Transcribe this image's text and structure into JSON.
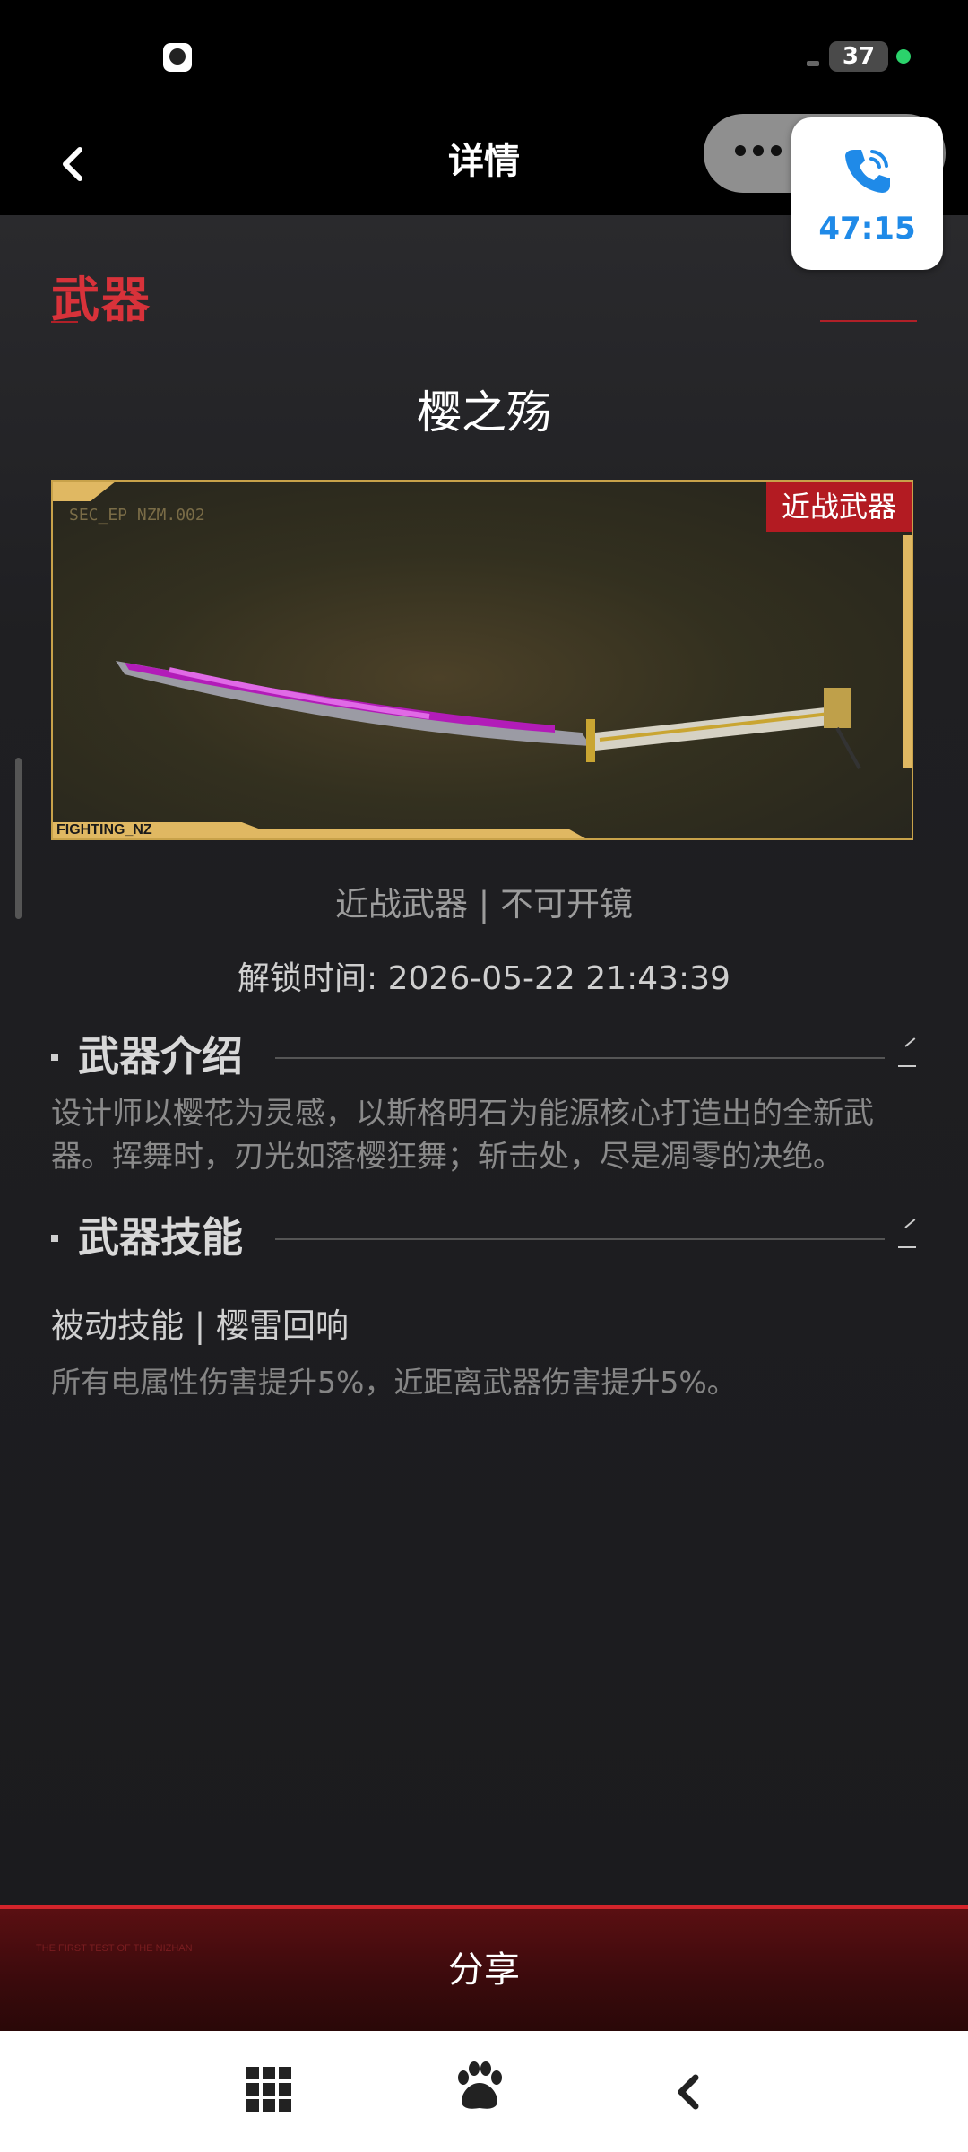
{
  "status_bar": {
    "battery": "37"
  },
  "header": {
    "title": "详情"
  },
  "call_widget": {
    "time": "47:15"
  },
  "section": {
    "title": "武器"
  },
  "weapon": {
    "name": "樱之殇",
    "badge": "近战武器",
    "image_code": "SEC_EP NZM.002",
    "image_footer": "FIGHTING_NZ",
    "type_line": "近战武器 | 不可开镜",
    "unlock_time": "解锁时间: 2026-05-22 21:43:39"
  },
  "intro": {
    "title": "武器介绍",
    "text": "设计师以樱花为灵感，以斯格明石为能源核心打造出的全新武器。挥舞时，刃光如落樱狂舞；斩击处，尽是凋零的决绝。"
  },
  "skills": {
    "title": "武器技能",
    "name": "被动技能 | 樱雷回响",
    "description": "所有电属性伤害提升5%，近距离武器伤害提升5%。"
  },
  "share": {
    "label": "分享",
    "tag": "THE FIRST TEST OF THE NIZHAN"
  }
}
